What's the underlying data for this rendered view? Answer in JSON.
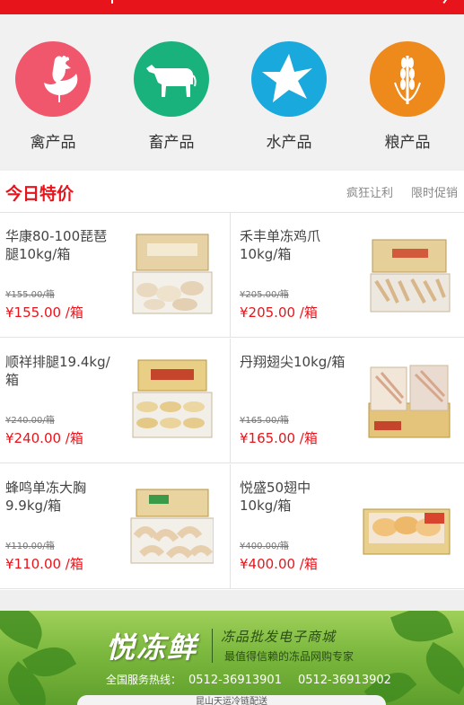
{
  "categories": [
    {
      "label": "禽产品",
      "icon": "rooster-icon",
      "color": "#f0566c"
    },
    {
      "label": "畜产品",
      "icon": "cow-icon",
      "color": "#1ab27c"
    },
    {
      "label": "水产品",
      "icon": "starfish-icon",
      "color": "#1aa9dc"
    },
    {
      "label": "粮产品",
      "icon": "wheat-icon",
      "color": "#ee8a1c"
    }
  ],
  "section": {
    "title": "今日特价",
    "tags": [
      "疯狂让利",
      "限时促销"
    ]
  },
  "products": [
    {
      "name": "华康80-100琵琶腿10kg/箱",
      "old_price": "¥155.00/箱",
      "price": "¥155.00 /箱"
    },
    {
      "name": "禾丰单冻鸡爪10kg/箱",
      "old_price": "¥205.00/箱",
      "price": "¥205.00 /箱"
    },
    {
      "name": "顺祥排腿19.4kg/箱",
      "old_price": "¥240.00/箱",
      "price": "¥240.00 /箱"
    },
    {
      "name": "丹翔翅尖10kg/箱",
      "old_price": "¥165.00/箱",
      "price": "¥165.00 /箱"
    },
    {
      "name": "蜂鸣单冻大胸9.9kg/箱",
      "old_price": "¥110.00/箱",
      "price": "¥110.00 /箱"
    },
    {
      "name": "悦盛50翅中10kg/箱",
      "old_price": "¥400.00/箱",
      "price": "¥400.00 /箱"
    }
  ],
  "banner": {
    "brand": "悦冻鲜",
    "slogan1": "冻品批发电子商城",
    "slogan2": "最值得信赖的冻品网购专家",
    "hotline_label": "全国服务热线：",
    "phone1": "0512-36913901",
    "phone2": "0512-36913902",
    "pill_text": "昆山天运冷链配送"
  },
  "colors": {
    "accent": "#e8141b"
  }
}
